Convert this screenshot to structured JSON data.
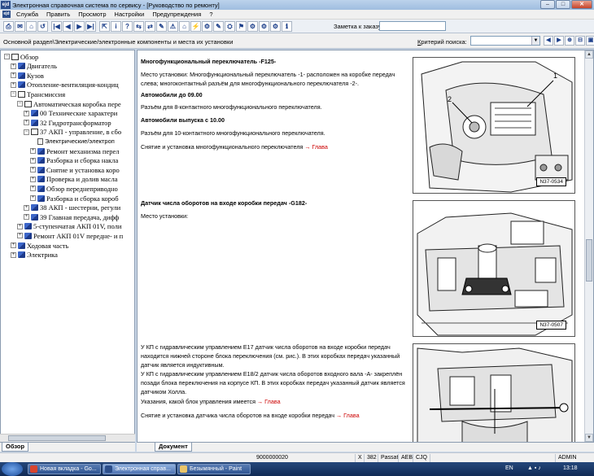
{
  "window": {
    "logo": "ejd",
    "title": "Электронная справочная система по сервису - [Руководство по ремонту]",
    "btn_min": "–",
    "btn_max": "□",
    "btn_close": "✕"
  },
  "menu": {
    "logo": "ejd",
    "items": [
      "Служба",
      "Править",
      "Просмотр",
      "Настройки",
      "Предупреждения",
      "?"
    ]
  },
  "toolbar": {
    "buttons": [
      "⎙",
      "✉",
      "⌂",
      "↺",
      "|◀",
      "◀",
      "▶",
      "▶|",
      "⇱",
      "i",
      "?",
      "⇆",
      "⇄",
      "✎",
      "⚠",
      "⌂",
      "⚡",
      "⚙",
      "✎",
      "⛭",
      "⚑",
      "⚙",
      "⚙",
      "⚙",
      "ℹ"
    ],
    "order_label": "Заметка к заказу:"
  },
  "address": {
    "path": "Основной раздел\\Электрические/электронные компоненты и места их установки",
    "criteria_u": "К",
    "criteria_rest": "ритерий поиска:",
    "crit_buttons": [
      "◀",
      "▶",
      "⊕",
      "⊟",
      "▣"
    ]
  },
  "tree": [
    {
      "exp": "⊟",
      "icon": "open",
      "label": "Обзор",
      "level": 0
    },
    {
      "exp": "⊞",
      "icon": "blue",
      "label": "Двигатель",
      "level": 1
    },
    {
      "exp": "⊞",
      "icon": "blue",
      "label": "Кузов",
      "level": 1
    },
    {
      "exp": "⊞",
      "icon": "blue",
      "label": "Отопление-вентиляция-кондиц",
      "level": 1
    },
    {
      "exp": "⊟",
      "icon": "open",
      "label": "Трансмиссия",
      "level": 1
    },
    {
      "exp": "⊟",
      "icon": "open",
      "label": "Автоматическая коробка пере",
      "level": 2
    },
    {
      "exp": "⊞",
      "icon": "blue",
      "label": "00 Технические характери",
      "level": 3
    },
    {
      "exp": "⊞",
      "icon": "blue",
      "label": "32 Гидротрансформатор",
      "level": 3
    },
    {
      "exp": "⊟",
      "icon": "open",
      "label": "37 АКП - управление, в сбо",
      "level": 3
    },
    {
      "exp": "",
      "icon": "doc",
      "label": "Электрические/электроп",
      "level": 4
    },
    {
      "exp": "⊞",
      "icon": "blue",
      "label": "Ремонт механизма перел",
      "level": 4
    },
    {
      "exp": "⊞",
      "icon": "blue",
      "label": "Разборка и сборка накла",
      "level": 4
    },
    {
      "exp": "⊞",
      "icon": "blue",
      "label": "Снятие и установка коро",
      "level": 4
    },
    {
      "exp": "⊞",
      "icon": "blue",
      "label": "Проверка и долив масла",
      "level": 4
    },
    {
      "exp": "⊞",
      "icon": "blue",
      "label": "Обзор переднеприводно",
      "level": 4
    },
    {
      "exp": "⊞",
      "icon": "blue",
      "label": "Разборка и сборка короб",
      "level": 4
    },
    {
      "exp": "⊞",
      "icon": "blue",
      "label": "38 АКП - шестерни, регули",
      "level": 3
    },
    {
      "exp": "⊞",
      "icon": "blue",
      "label": "39 Главная передача, дифф",
      "level": 3
    },
    {
      "exp": "⊞",
      "icon": "blue",
      "label": "5-ступенчатая АКП 01V, поли",
      "level": 2
    },
    {
      "exp": "⊞",
      "icon": "blue",
      "label": "Ремонт АКП 01V передне- и п",
      "level": 2
    },
    {
      "exp": "⊞",
      "icon": "blue",
      "label": "Ходовая часть",
      "level": 1
    },
    {
      "exp": "⊞",
      "icon": "blue",
      "label": "Электрика",
      "level": 1
    }
  ],
  "left_tab": "Обзор",
  "right_tab": "Документ",
  "doc": {
    "s1_title": "Многофункциональный переключатель -F125-",
    "s1_p1": "Место установки: Многофункциональный переключатель -1- расположен на коробке передач слева; многоконтактный разъём для многофункционального переключателя -2-.",
    "s1_h1": "Автомобили до 09.00",
    "s1_p2": "Разъём для 8-контактного многофункционального переключателя.",
    "s1_h2": "Автомобили выпуска с 10.00",
    "s1_p3": "Разъём для 10-контактного многофункционального переключателя.",
    "s1_p4": "Снятие и установка многофункционального переключателя",
    "link_arrow": "→",
    "link_word": "Глава",
    "s2_title": "Датчик числа оборотов на входе коробки передач -G182-",
    "s2_p1": "Место установки:",
    "s3_p1": "У КП с гидравлическим управлением E17 датчик числа оборотов на входе коробки передач находится нижней стороне блока переключения (см. рис.). В этих коробках передач указанный датчик является индуктивным.",
    "s3_p2": "У КП с гидравлическим управлением E18/2 датчик числа оборотов входного вала -A- закреплён позади блока переключения на корпусе КП. В этих коробках передач указанный датчик является датчиком Холла.",
    "s3_p3": "Указания, какой блок управления имеется",
    "s3_p4": "Снятие и установка датчика числа оборотов на входе коробки передач",
    "fig1_code": "N37-0534",
    "fig1_label1": "1",
    "fig1_label2": "2",
    "fig2_code": "N37-0507"
  },
  "status": {
    "num": "9000000020",
    "cells": [
      "X",
      "382",
      "Passat",
      "AEB",
      "CJQ"
    ],
    "user": "ADMIN"
  },
  "taskbar": {
    "tasks": [
      "Новая вкладка - Go...",
      "Электронная справ...",
      "Безымянный - Paint"
    ],
    "lang": "EN",
    "time": "13:18"
  }
}
